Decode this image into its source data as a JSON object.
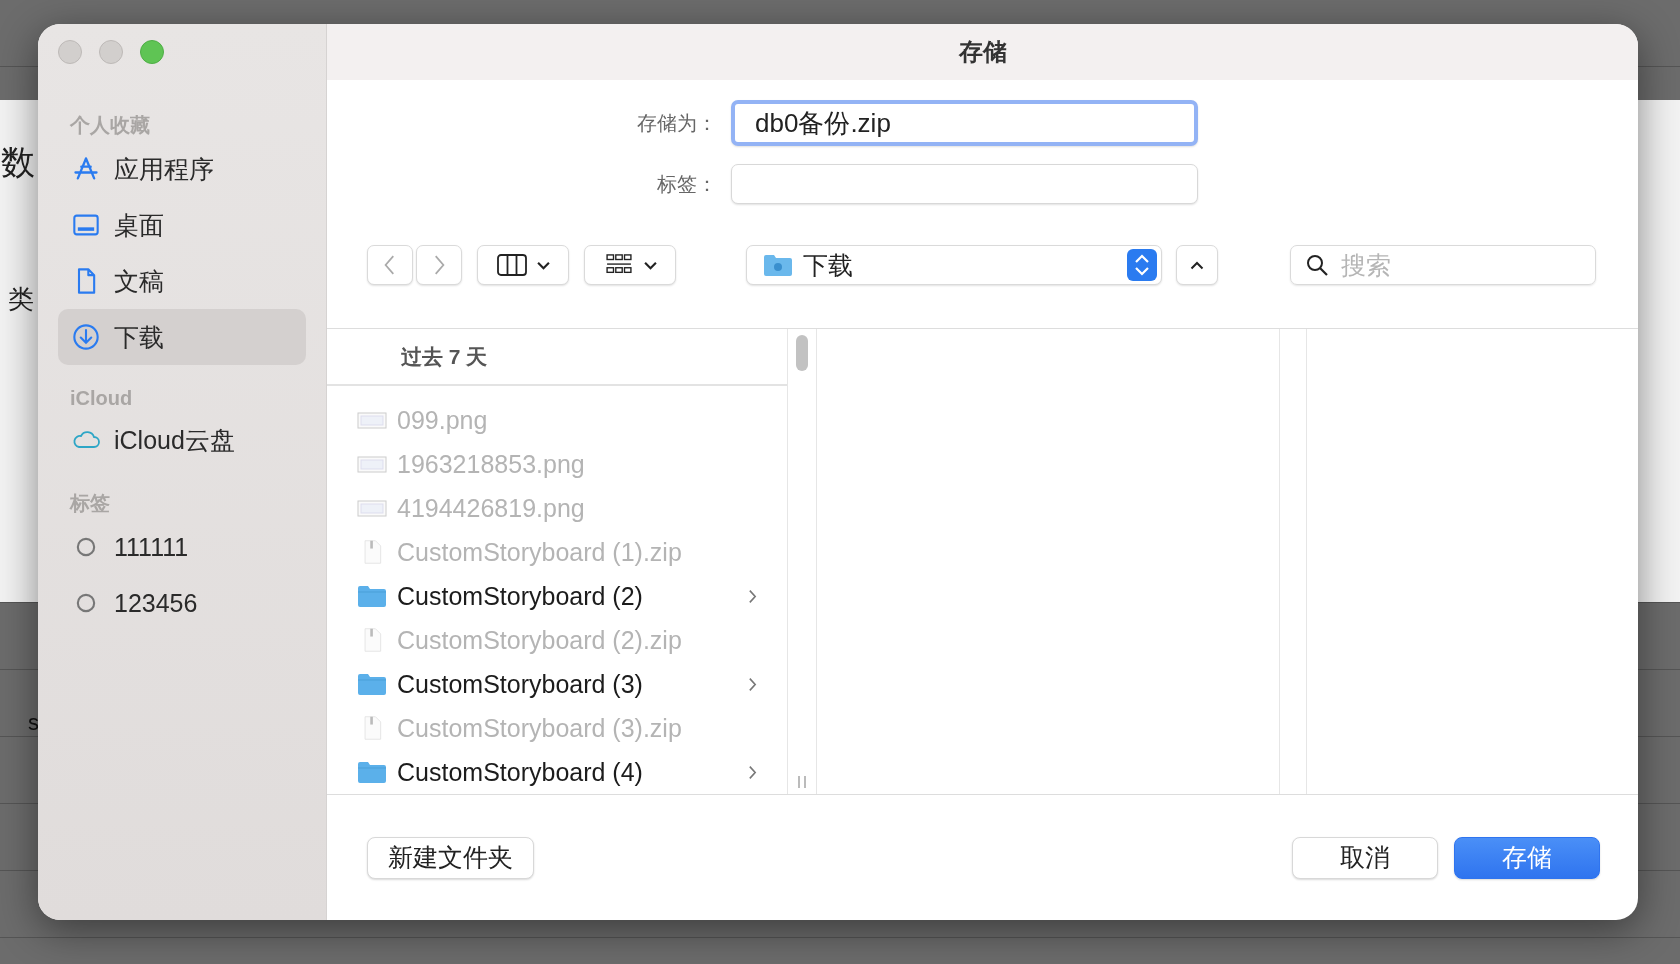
{
  "background": {
    "texts": [
      "数",
      "类",
      "s"
    ]
  },
  "dialog": {
    "title": "存储",
    "sidebar": [
      {
        "heading": "个人收藏",
        "items": [
          {
            "label": "应用程序",
            "kind": "apps",
            "selected": false
          },
          {
            "label": "桌面",
            "kind": "desktop",
            "selected": false
          },
          {
            "label": "文稿",
            "kind": "document",
            "selected": false
          },
          {
            "label": "下载",
            "kind": "download",
            "selected": true
          }
        ]
      },
      {
        "heading": "iCloud",
        "items": [
          {
            "label": "iCloud云盘",
            "kind": "cloud",
            "selected": false
          }
        ]
      },
      {
        "heading": "标签",
        "items": [
          {
            "label": "111111",
            "kind": "tag",
            "selected": false
          },
          {
            "label": "123456",
            "kind": "tag",
            "selected": false
          }
        ]
      }
    ],
    "save_as": {
      "label": "存储为：",
      "value": "db0备份.zip"
    },
    "tags": {
      "label": "标签："
    },
    "location": "下载",
    "search": {
      "placeholder": "搜索"
    },
    "browser": {
      "group_header": "过去 7 天",
      "files": [
        {
          "name": "099.png",
          "kind": "image",
          "disabled": true
        },
        {
          "name": "1963218853.png",
          "kind": "image",
          "disabled": true
        },
        {
          "name": "4194426819.png",
          "kind": "image",
          "disabled": true
        },
        {
          "name": "CustomStoryboard (1).zip",
          "kind": "zip",
          "disabled": true
        },
        {
          "name": "CustomStoryboard (2)",
          "kind": "folder",
          "disabled": false
        },
        {
          "name": "CustomStoryboard (2).zip",
          "kind": "zip",
          "disabled": true
        },
        {
          "name": "CustomStoryboard (3)",
          "kind": "folder",
          "disabled": false
        },
        {
          "name": "CustomStoryboard (3).zip",
          "kind": "zip",
          "disabled": true
        },
        {
          "name": "CustomStoryboard (4)",
          "kind": "folder",
          "disabled": false
        }
      ]
    },
    "buttons": {
      "new_folder": "新建文件夹",
      "cancel": "取消",
      "save": "存储"
    }
  }
}
